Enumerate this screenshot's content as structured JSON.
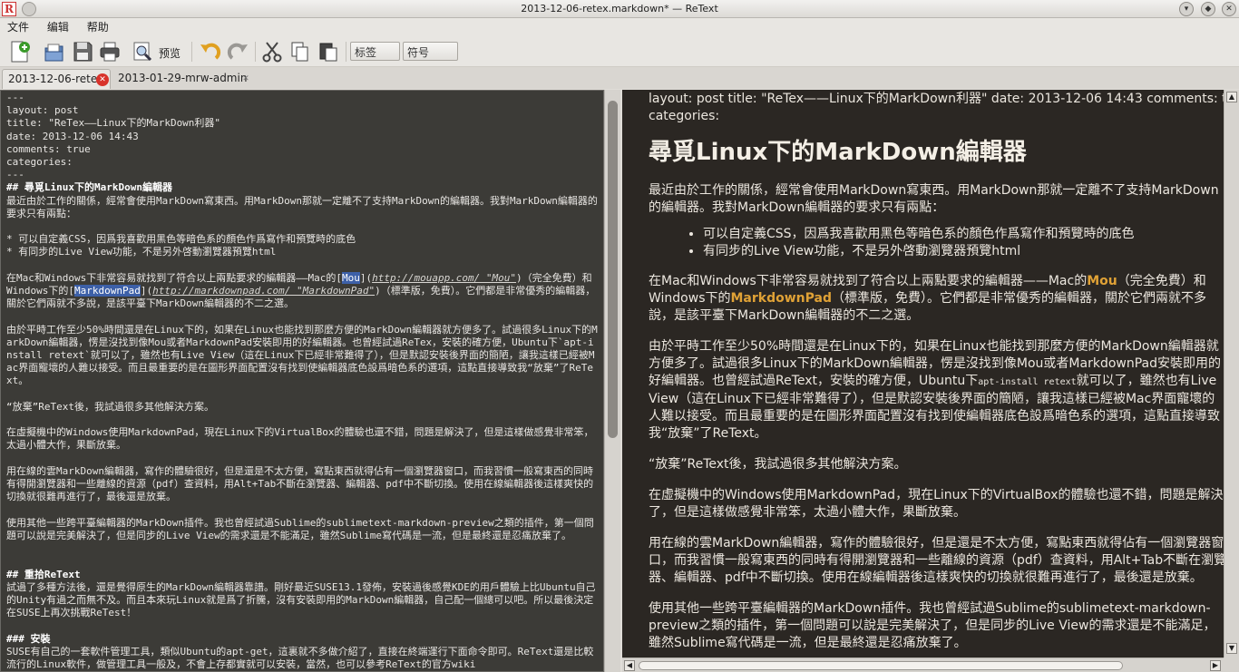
{
  "window": {
    "title": "2013-12-06-retex.markdown* — ReText"
  },
  "menu": [
    "文件",
    "编辑",
    "帮助"
  ],
  "toolbar": {
    "preview_label": "预览",
    "tags_placeholder": "标签",
    "symbols_placeholder": "符号"
  },
  "tabs": [
    {
      "label": "2013-12-06-retex",
      "active": true
    },
    {
      "label": "2013-01-29-mrw-admin",
      "active": false
    }
  ],
  "editor": {
    "front_matter": [
      "---",
      "layout: post",
      "title: \"ReTex——Linux下的MarkDown利器\"",
      "date: 2013-12-06 14:43",
      "comments: true",
      "categories:",
      "---"
    ],
    "h2_1": "## 尋覓Linux下的MarkDown編輯器",
    "p1": "最近由於工作的關係，經常會使用MarkDown寫東西。用MarkDown那就一定離不了支持MarkDown的編輯器。我對MarkDown編輯器的要求只有兩點：",
    "li1": "* 可以自定義CSS，因爲我喜歡用黑色等暗色系的顏色作爲寫作和預覽時的底色",
    "li2": "* 有同步的Live View功能，不是另外啓動瀏覽器預覽html",
    "p2_a": "在Mac和Windows下非常容易就找到了符合以上兩點要求的編輯器——Mac的[",
    "p2_link1": "Mou",
    "p2_b": "](",
    "p2_url1": "http://mouapp.com/ \"Mou\"",
    "p2_c": ")（完全免費）和Windows下的[",
    "p2_link2": "MarkdownPad",
    "p2_d": "](",
    "p2_url2": "http://markdownpad.com/ \"MarkdownPad\"",
    "p2_e": ")（標準版，免費）。它們都是非常優秀的編輯器，關於它們兩就不多說，是該平臺下MarkDown編輯器的不二之選。",
    "p3": "由於平時工作至少50%時間還是在Linux下的，如果在Linux也能找到那麼方便的MarkDown編輯器就方便多了。試過很多Linux下的MarkDown編輯器，愣是沒找到像Mou或者MarkdownPad安裝即用的好編輯器。也曾經試過ReTex，安裝的確方便，Ubuntu下`apt-install retext`就可以了，雖然也有Live View（這在Linux下已經非常難得了），但是默認安裝後界面的簡陋，讓我這樣已經被Mac界面寵壞的人難以接受。而且最重要的是在圖形界面配置沒有找到使編輯器底色設爲暗色系的選項，這點直接導致我“放棄”了ReText。",
    "p4": "“放棄”ReText後，我試過很多其他解決方案。",
    "p5": "在虛擬機中的Windows使用MarkdownPad，現在Linux下的VirtualBox的體驗也還不錯，問題是解決了，但是這樣做感覺非常笨，太過小體大作，果斷放棄。",
    "p6": "用在線的雲MarkDown編輯器，寫作的體驗很好，但是還是不太方便，寫點東西就得佔有一個瀏覽器窗口，而我習慣一般寫東西的同時有得開瀏覽器和一些離線的資源（pdf）查資料，用Alt+Tab不斷在瀏覽器、編輯器、pdf中不斷切換。使用在線編輯器後這樣爽快的切換就很難再進行了，最後還是放棄。",
    "p7": "使用其他一些跨平臺編輯器的MarkDown插件。我也曾經試過Sublime的sublimetext-markdown-preview之類的插件，第一個問題可以說是完美解決了，但是同步的Live View的需求還是不能滿足，雖然Sublime寫代碼是一流，但是最終還是忍痛放棄了。",
    "h2_2": "## 重拾ReText",
    "p8": "試過了多種方法後，還是覺得原生的MarkDown編輯器靠譜。剛好最近SUSE13.1發佈，安裝過後感覺KDE的用戶體驗上比Ubuntu自己的Unity有過之而無不及。而且本來玩Linux就是爲了折騰，沒有安裝即用的MarkDown編輯器，自己配一個總可以吧。所以最後決定在SUSE上再次挑戰ReTest！",
    "h3_1": "### 安裝",
    "p9": "SUSE有自己的一套軟件管理工具，類似Ubuntu的apt-get，這裏就不多做介紹了，直接在終端運行下面命令即可。ReText還是比較流行的Linux軟件，做管理工具一般及，不會上存都實就可以安裝，當然，也可以參考ReText的官方wiki"
  },
  "preview": {
    "meta_line1": "layout: post title: \"ReTex——Linux下的MarkDown利器\" date: 2013-12-06 14:43 comments: true",
    "meta_line2": "categories:",
    "h2": "尋覓Linux下的MarkDown編輯器",
    "p1": "最近由於工作的關係，經常會使用MarkDown寫東西。用MarkDown那就一定離不了支持MarkDown的編輯器。我對MarkDown編輯器的要求只有兩點：",
    "li1": "可以自定義CSS，因爲我喜歡用黑色等暗色系的顏色作爲寫作和預覽時的底色",
    "li2": "有同步的Live View功能，不是另外啓動瀏覽器預覽html",
    "p2_a": "在Mac和Windows下非常容易就找到了符合以上兩點要求的編輯器——Mac的",
    "p2_link1": "Mou",
    "p2_b": "（完全免費）和Windows下的",
    "p2_link2": "MarkdownPad",
    "p2_c": "（標準版，免費）。它們都是非常優秀的編輯器，關於它們兩就不多說，是該平臺下MarkDown編輯器的不二之選。",
    "p3_a": "由於平時工作至少50%時間還是在Linux下的，如果在Linux也能找到那麼方便的MarkDown編輯器就方便多了。試過很多Linux下的MarkDown編輯器，愣是沒找到像Mou或者MarkdownPad安裝即用的好編輯器。也曾經試過ReText，安裝的確方便，Ubuntu下",
    "p3_code": "apt-install retext",
    "p3_b": "就可以了，雖然也有Live View（這在Linux下已經非常難得了），但是默認安裝後界面的簡陋，讓我這樣已經被Mac界面寵壞的人難以接受。而且最重要的是在圖形界面配置沒有找到使編輯器底色設爲暗色系的選項，這點直接導致我“放棄”了ReText。",
    "p4": "“放棄”ReText後，我試過很多其他解決方案。",
    "p5": "在虛擬機中的Windows使用MarkdownPad，現在Linux下的VirtualBox的體驗也還不錯，問題是解決了，但是這樣做感覺非常笨，太過小體大作，果斷放棄。",
    "p6": "用在線的雲MarkDown編輯器，寫作的體驗很好，但是還是不太方便，寫點東西就得佔有一個瀏覽器窗口，而我習慣一般寫東西的同時有得開瀏覽器和一些離線的資源（pdf）查資料，用Alt+Tab不斷在瀏覽器、編輯器、pdf中不斷切換。使用在線編輯器後這樣爽快的切換就很難再進行了，最後還是放棄。",
    "p7": "使用其他一些跨平臺編輯器的MarkDown插件。我也曾經試過Sublime的sublimetext-markdown-preview之類的插件，第一個問題可以說是完美解決了，但是同步的Live View的需求還是不能滿足，雖然Sublime寫代碼是一流，但是最終還是忍痛放棄了。"
  },
  "colors": {
    "editor_bg": "#3c3b37",
    "preview_bg": "#2b2723",
    "link": "#e0a236",
    "close_active": "#d8332b"
  }
}
